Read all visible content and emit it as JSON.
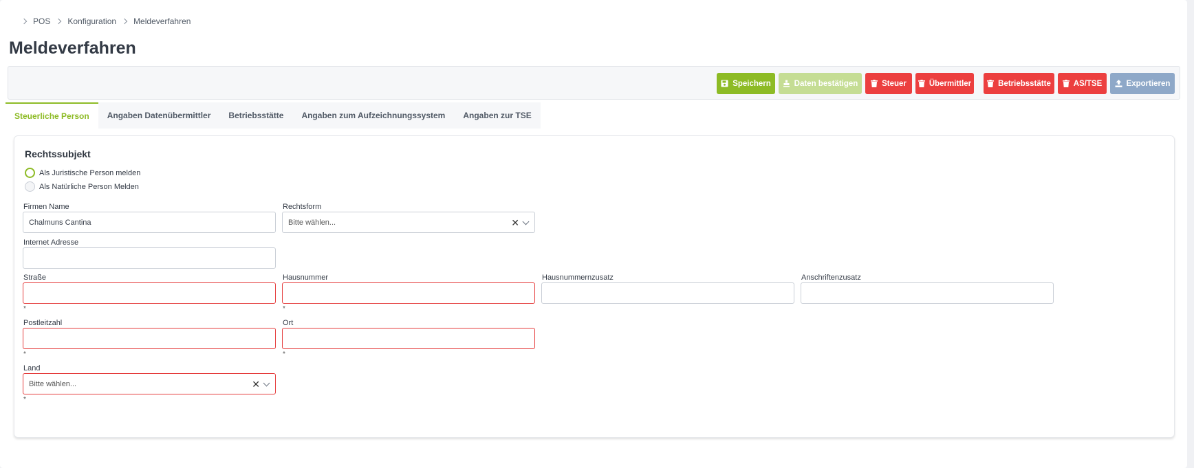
{
  "breadcrumb": {
    "items": [
      "POS",
      "Konfiguration",
      "Meldeverfahren"
    ]
  },
  "page": {
    "title": "Meldeverfahren"
  },
  "toolbar": {
    "save": "Speichern",
    "confirm": "Daten bestätigen",
    "tax": "Steuer",
    "transmitter": "Übermittler",
    "site": "Betriebsstätte",
    "astse": "AS/TSE",
    "export": "Exportieren"
  },
  "tabs": [
    "Steuerliche Person",
    "Angaben Datenübermittler",
    "Betriebsstätte",
    "Angaben zum Aufzeichnungssystem",
    "Angaben zur TSE"
  ],
  "form": {
    "section_title": "Rechtssubjekt",
    "radio_legal": "Als Juristische Person melden",
    "radio_natural": "Als Natürliche Person Melden",
    "company_label": "Firmen Name",
    "company_value": "Chalmuns Cantina",
    "legalform_label": "Rechtsform",
    "legalform_placeholder": "Bitte wählen...",
    "website_label": "Internet Adresse",
    "website_value": "",
    "street_label": "Straße",
    "housenumber_label": "Hausnummer",
    "housenumber_suffix_label": "Hausnummernzusatz",
    "address_suffix_label": "Anschriftenzusatz",
    "zip_label": "Postleitzahl",
    "city_label": "Ort",
    "country_label": "Land",
    "country_placeholder": "Bitte wählen...",
    "required_mark": "*"
  },
  "colors": {
    "accent": "#8dbb25",
    "danger": "#ec3f3f",
    "export": "#8ea8c8"
  }
}
